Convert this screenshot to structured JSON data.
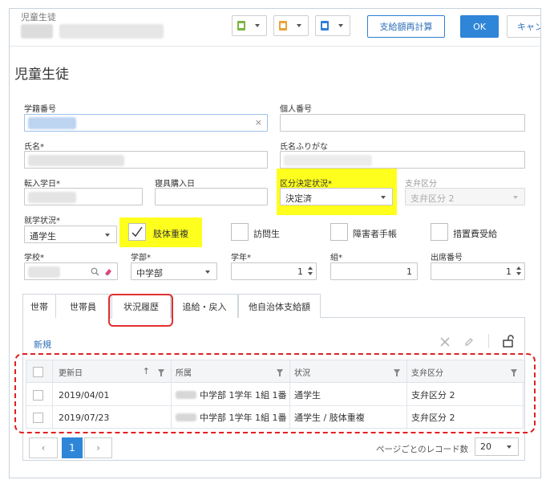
{
  "header": {
    "title": "児童生徒",
    "recalc_label": "支給額再計算",
    "ok_label": "OK",
    "cancel_label": "キャン",
    "colors": {
      "green": "#7cb342",
      "orange": "#e8a33a",
      "blue": "#2f86d8"
    }
  },
  "page": {
    "title": "児童生徒"
  },
  "fields": {
    "gakuseki": {
      "label": "学籍番号"
    },
    "kojin": {
      "label": "個人番号"
    },
    "shimei": {
      "label": "氏名*"
    },
    "furigana": {
      "label": "氏名ふりがな"
    },
    "tennyu": {
      "label": "転入学日*"
    },
    "shingu": {
      "label": "寝具購入日"
    },
    "kubun": {
      "label": "区分決定状況*",
      "value": "決定済"
    },
    "shiben": {
      "label": "支弁区分",
      "value": "支弁区分 2"
    },
    "shugaku": {
      "label": "就学状況*",
      "value": "通学生"
    },
    "gakko": {
      "label": "学校*"
    },
    "gakubu": {
      "label": "学部*",
      "value": "中学部"
    },
    "gakunen": {
      "label": "学年*",
      "value": "1"
    },
    "kumi": {
      "label": "組*",
      "value": "1"
    },
    "shusseki": {
      "label": "出席番号",
      "value": "1"
    }
  },
  "checks": {
    "shitai": {
      "label": "肢体重複",
      "checked": true
    },
    "homon": {
      "label": "訪問生",
      "checked": false
    },
    "techo": {
      "label": "障害者手帳",
      "checked": false
    },
    "sochi": {
      "label": "措置費受給",
      "checked": false
    }
  },
  "tabs": [
    {
      "label": "世帯"
    },
    {
      "label": "世帯員"
    },
    {
      "label": "状況履歴",
      "active": true
    },
    {
      "label": "追給・戻入"
    },
    {
      "label": "他自治体支給額"
    }
  ],
  "grid": {
    "new_label": "新規",
    "columns": [
      "更新日",
      "所属",
      "状況",
      "支弁区分"
    ],
    "rows": [
      {
        "date": "2019/04/01",
        "shozoku": "中学部 1学年 1組 1番",
        "jokyo": "通学生",
        "shiben": "支弁区分 2"
      },
      {
        "date": "2019/07/23",
        "shozoku": "中学部 1学年 1組 1番",
        "jokyo": "通学生 / 肢体重複",
        "shiben": "支弁区分 2"
      }
    ]
  },
  "pager": {
    "prev": "‹",
    "current": "1",
    "next": "›",
    "per_page_label": "ページごとのレコード数",
    "per_page_value": "20"
  }
}
